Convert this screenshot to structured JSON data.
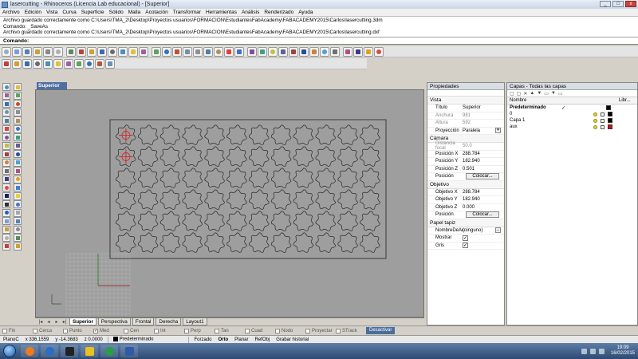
{
  "window": {
    "title": "lasercutting - Rhinoceros (Licencia Lab educacional) - [Superior]",
    "min": "_",
    "max": "□",
    "close": "x"
  },
  "menu": [
    "Archivo",
    "Edición",
    "Vista",
    "Curva",
    "Superficie",
    "Sólido",
    "Malla",
    "Acotación",
    "Transformar",
    "Herramientas",
    "Análisis",
    "Renderizado",
    "Ayuda"
  ],
  "command": {
    "history": [
      "Archivo guardado correctamente como C:\\Users\\TMA_2\\Desktop\\Proyectos usuarios\\FORMACION\\EstudiantesFabAcademy\\FABACADEMY2015\\Carlos\\lasercutting.3dm",
      "Comando: _SaveAs",
      "Archivo guardado correctamente como C:\\Users\\TMA_2\\Desktop\\Proyectos usuarios\\FORMACION\\EstudiantesFabAcademy\\FABACADEMY2015\\Carlos\\lasercutting.dxf"
    ],
    "prompt": "Comando:"
  },
  "toolbar_colors": [
    "#9ab",
    "#7a9fd6",
    "#5b7fb8",
    "#c8a040",
    "#8a8a8a",
    "#b0b0b0",
    "#5a8a5a",
    "#c04040",
    "#d0a030",
    "#3a6ab0",
    "#6a6a6a",
    "#4a90c0",
    "#e0c040",
    "#a060a0",
    "#60a060",
    "#3070c0",
    "#c05030",
    "#7090b0",
    "#909090",
    "#5080a0",
    "#b09060",
    "#e04040",
    "#4070d0",
    "#8050a0",
    "#40a080",
    "#c0c040",
    "#606090",
    "#a04040",
    "#2050a0",
    "#d08040",
    "#50a0d0",
    "#707070",
    "#b05080",
    "#3a3a8a",
    "#e0a020",
    "#e04848",
    "#3a80e0",
    "#102060",
    "#e8d040",
    "#303030",
    "#5070d0",
    "#2060c0"
  ],
  "viewport": {
    "name": "Superior",
    "sheet_grid": {
      "cols": 12,
      "rows": 6
    }
  },
  "viewport_tabs": [
    "Superior",
    "Perspectiva",
    "Frontal",
    "Derecha",
    "Layout1"
  ],
  "viewport_tab_nav": [
    "|◂",
    "◂",
    "▸",
    "▸|"
  ],
  "properties": {
    "title": "Propiedades",
    "sections": {
      "vista": "Vista",
      "camara": "Cámara",
      "objetivo": "Objetivo",
      "papel": "Papel tapiz"
    },
    "vista": [
      {
        "key": "Título",
        "value": "Superior"
      },
      {
        "key": "Anchura",
        "value": "981",
        "dim": true
      },
      {
        "key": "Altura",
        "value": "592",
        "dim": true
      },
      {
        "key": "Proyección",
        "value": "Paralela"
      }
    ],
    "camara": [
      {
        "key": "Distancia focal",
        "value": "50.0",
        "dim": true
      },
      {
        "key": "Posición X",
        "value": "288.784"
      },
      {
        "key": "Posición Y",
        "value": "182.940"
      },
      {
        "key": "Posición Z",
        "value": "0.501"
      },
      {
        "key": "Posición",
        "button": "Colocar..."
      }
    ],
    "objetivo": [
      {
        "key": "Objetivo X",
        "value": "288.784"
      },
      {
        "key": "Objetivo Y",
        "value": "182.940"
      },
      {
        "key": "Objetivo Z",
        "value": "0.000"
      },
      {
        "key": "Posición",
        "button": "Colocar..."
      }
    ],
    "papel": [
      {
        "key": "NombreDeAr...",
        "value": "(ninguno)"
      },
      {
        "key": "Mostrar",
        "check": "✓"
      },
      {
        "key": "Gris",
        "check": "✓"
      }
    ],
    "dropdown_glyph": "▾",
    "browse_glyph": "..."
  },
  "layers": {
    "title": "Capas - Todas las capas",
    "tool_glyphs": [
      "▢",
      "▢",
      "✕",
      "▲",
      "▼",
      "▭",
      "▼",
      "▭"
    ],
    "col_name": "Nombre",
    "col_material": "Libr...",
    "items": [
      {
        "name": "Predeterminado",
        "current": "✓",
        "color": "#000000",
        "bold": true
      },
      {
        "name": "0",
        "color": "#000000"
      },
      {
        "name": "Capa 1",
        "color": "#000000"
      },
      {
        "name": "aux",
        "color": "#d01010"
      }
    ]
  },
  "osnap": {
    "items": [
      {
        "label": "Fin",
        "checked": false
      },
      {
        "label": "Cerca",
        "checked": false
      },
      {
        "label": "Punto",
        "checked": false
      },
      {
        "label": "Med",
        "checked": true
      },
      {
        "label": "Cen",
        "checked": false
      },
      {
        "label": "Int",
        "checked": false
      },
      {
        "label": "Perp",
        "checked": false
      },
      {
        "label": "Tan",
        "checked": false
      },
      {
        "label": "Cuad",
        "checked": false
      },
      {
        "label": "Nodo",
        "checked": false
      },
      {
        "label": "Proyectar",
        "checked": false
      },
      {
        "label": "STrack",
        "checked": false
      }
    ],
    "check_glyph": "✓",
    "deactivate": "Desactivar"
  },
  "status": {
    "cplane": "PlanoC",
    "x": "x 336.1559",
    "y": "y -14.3683",
    "z": "z 0.0000",
    "layer": "Predeterminado",
    "toggles": [
      "Forzado",
      "Orto",
      "Planar",
      "RefObj",
      "Grabar historial"
    ]
  },
  "taskbar": {
    "time": "19:09",
    "date": "16/02/2015",
    "app_colors": [
      "#f07a20",
      "#2b6cc4",
      "#222222",
      "#e8c020",
      "#2a9d4a",
      "#2f5aa8"
    ]
  }
}
